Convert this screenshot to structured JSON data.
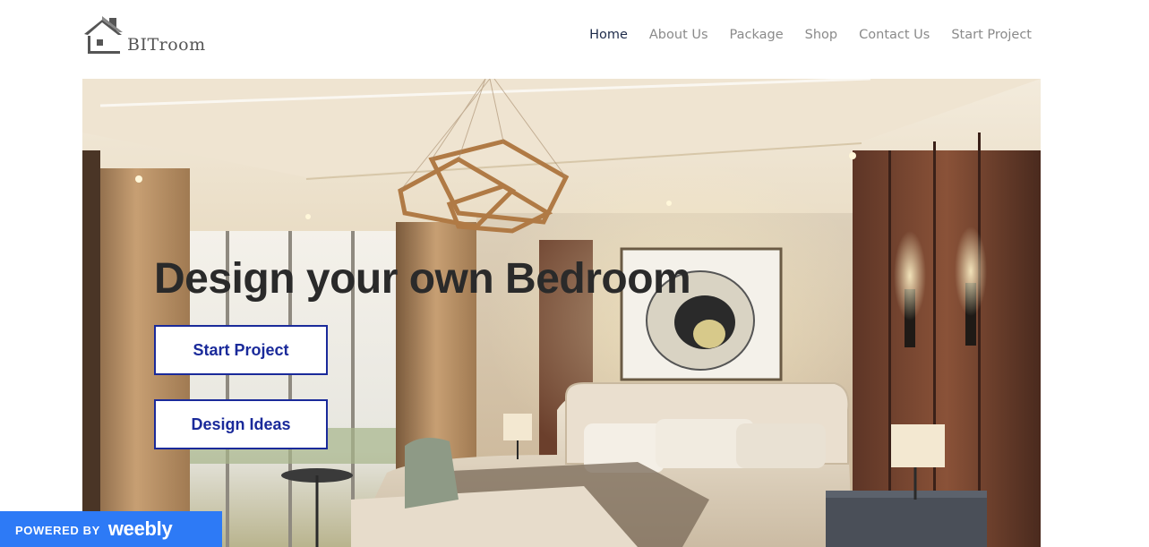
{
  "header": {
    "logo_text": "BITroom",
    "nav": [
      {
        "label": "Home",
        "active": true
      },
      {
        "label": "About Us",
        "active": false
      },
      {
        "label": "Package",
        "active": false
      },
      {
        "label": "Shop",
        "active": false
      },
      {
        "label": "Contact Us",
        "active": false
      },
      {
        "label": "Start Project",
        "active": false
      }
    ]
  },
  "hero": {
    "title": "Design your own Bedroom",
    "buttons": {
      "start_project": "Start Project",
      "design_ideas": "Design Ideas"
    }
  },
  "footer_badge": {
    "prefix": "POWERED BY",
    "brand": "weebly"
  },
  "colors": {
    "nav_active": "#1e2b4a",
    "nav_inactive": "#8a8a8a",
    "button_accent": "#1a2a9a",
    "badge_bg": "#2d7af6"
  }
}
